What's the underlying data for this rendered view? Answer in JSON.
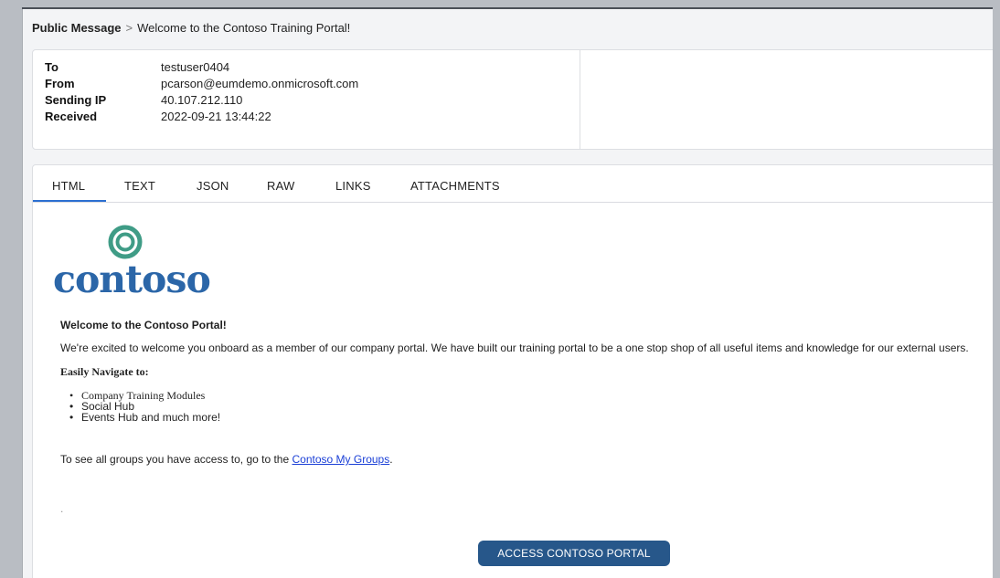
{
  "breadcrumb": {
    "section": "Public Message",
    "separator": ">",
    "subject": "Welcome to the Contoso Training Portal!"
  },
  "meta": {
    "to_label": "To",
    "to_value": "testuser0404",
    "from_label": "From",
    "from_value": "pcarson@eumdemo.onmicrosoft.com",
    "ip_label": "Sending IP",
    "ip_value": "40.107.212.110",
    "received_label": "Received",
    "received_value": "2022-09-21 13:44:22"
  },
  "tabs": [
    {
      "label": "HTML",
      "active": true
    },
    {
      "label": "TEXT"
    },
    {
      "label": "JSON"
    },
    {
      "label": "RAW"
    },
    {
      "label": "LINKS"
    },
    {
      "label": "ATTACHMENTS"
    }
  ],
  "email": {
    "logo_text": "contoso",
    "heading": "Welcome to the Contoso Portal!",
    "intro": "We're excited to welcome you onboard as a member of our company portal. We have built our training portal to be a one stop shop of all useful items and knowledge for our external users.",
    "nav_heading": "Easily Navigate to:",
    "nav_items": [
      "Company Training Modules",
      "Social Hub",
      "Events Hub and much more!"
    ],
    "groups_prefix": "To see all groups you have access to, go to the",
    "groups_link": "Contoso My Groups",
    "groups_suffix": ".",
    "dot": ".",
    "cta_label": "ACCESS CONTOSO PORTAL"
  },
  "colors": {
    "accent": "#2c6fd1",
    "logo_teal": "#3f9c86",
    "logo_blue": "#2b66a8",
    "cta": "#27578a",
    "link": "#1a3fd6"
  }
}
